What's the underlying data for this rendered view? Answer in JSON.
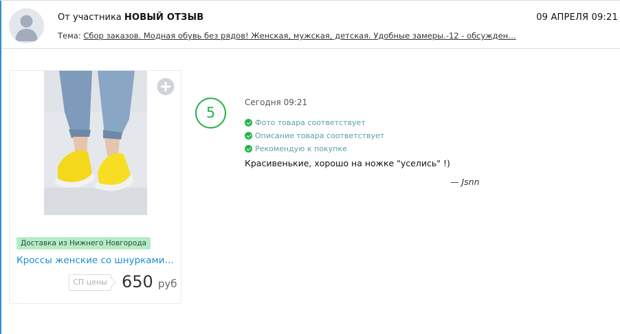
{
  "header": {
    "from_prefix": "От участника",
    "from_title": "НОВЫЙ ОТЗЫВ",
    "date": "09 АПРЕЛЯ 09:21",
    "topic_label": "Тема:",
    "topic_link": "Сбор заказов. Модная обувь без рядов! Женская, мужская, детская. Удобные замеры.-12 - обсужден…"
  },
  "product": {
    "delivery": "Доставка из Нижнего Новгорода",
    "title": "Кроссы женские со шнурками 1…",
    "price_badge": "СП цены",
    "price": "650",
    "currency": "руб",
    "icons": {
      "add": "plus-circle-icon"
    }
  },
  "review": {
    "rating": "5",
    "time": "Сегодня 09:21",
    "checks": [
      "Фото товара соответствует",
      "Описание товара соответствует",
      "Рекомендую к покупке"
    ],
    "text": "Красивенькие, хорошо на ножке \"уселись\" !)",
    "author": "— Jsnn"
  },
  "colors": {
    "accent_blue": "#1a8fd0",
    "rating_green": "#27b34a",
    "badge_green": "#b6ebc7",
    "check_text": "#5a9fa5"
  }
}
